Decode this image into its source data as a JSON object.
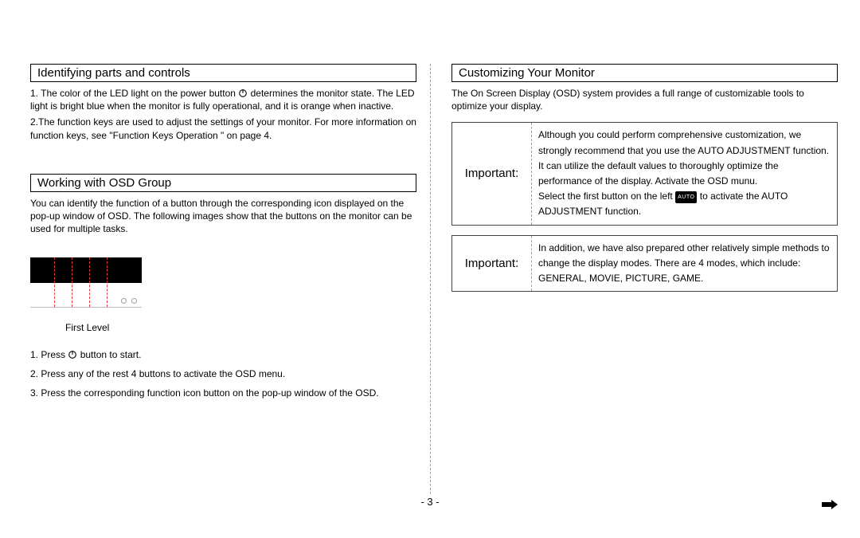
{
  "left": {
    "section1": {
      "title": "Identifying parts and controls",
      "p1a": "1. The color of the LED light on the power button ",
      "p1b": " determines the monitor state. The LED light is bright blue when the monitor is fully operational, and it is orange when inactive.",
      "p2": "2.The function keys are used to adjust the settings of your monitor. For more information on function keys, see \"Function Keys Operation    \" on page 4."
    },
    "section2": {
      "title": "Working with OSD Group",
      "p1": "You can identify the function of a button through the corresponding icon displayed on the pop-up window of OSD. The following images show that the buttons on the monitor can be used for multiple tasks.",
      "fig_caption": "First Level",
      "step1a": "1. Press ",
      "step1b": " button to start.",
      "step2": "2. Press any of the rest 4 buttons to activate the OSD menu.",
      "step3": "3. Press the corresponding function icon button on the pop-up window of the OSD."
    }
  },
  "right": {
    "section1": {
      "title": "Customizing Your Monitor",
      "p1": "The On Screen Display (OSD) system provides a full range of customizable tools to optimize your display."
    },
    "important1": {
      "label": "Important:",
      "line1": "Although you could perform comprehensive customization, we strongly recommend that you use the  AUTO ADJUSTMENT function.",
      "line2": "It can utilize the default values to thoroughly optimize the performance of the display. Activate the OSD munu.",
      "line3a": "Select the first button on the left ",
      "auto_badge": "AUTO",
      "line3b": " to activate the  AUTO ADJUSTMENT  function."
    },
    "important2": {
      "label": "Important:",
      "body": "In addition, we have also prepared other relatively simple methods to change the display modes. There are 4 modes, which include: GENERAL, MOVIE, PICTURE, GAME."
    }
  },
  "page_number": "- 3 -"
}
